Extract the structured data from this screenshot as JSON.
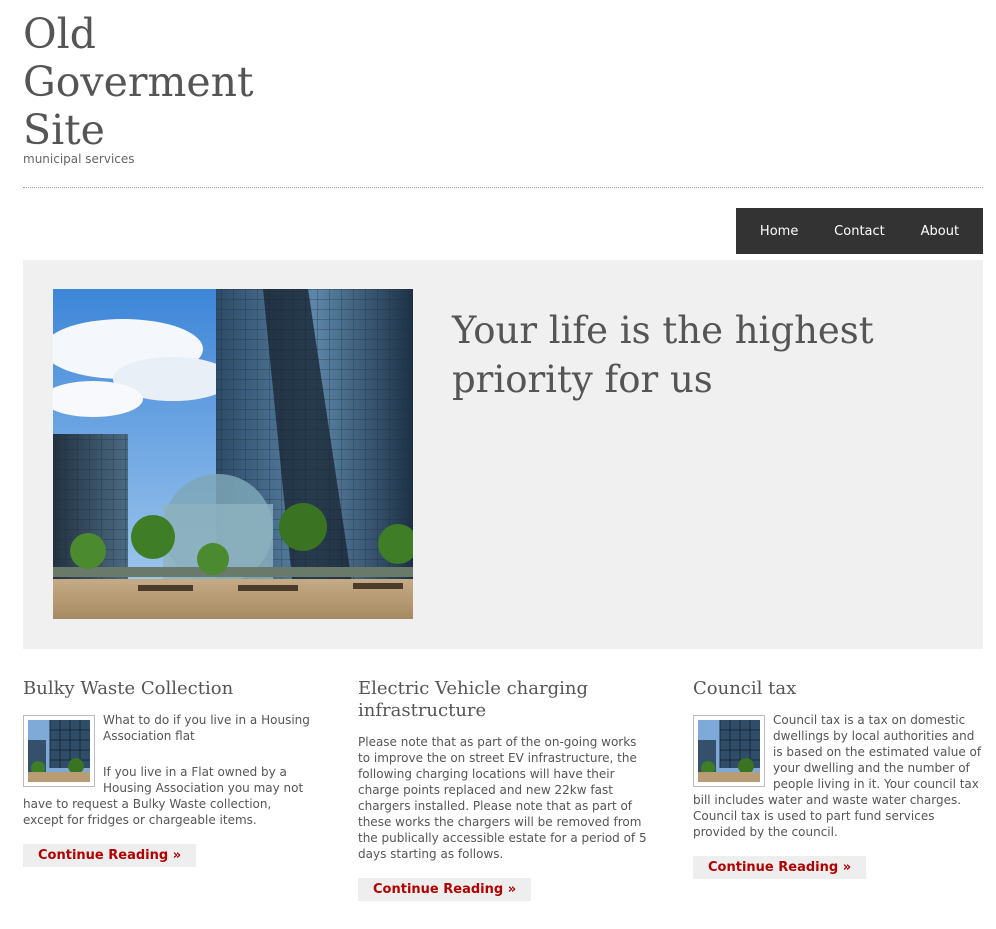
{
  "header": {
    "site_title": "Old Goverment Site",
    "tagline": "municipal services"
  },
  "nav": {
    "items": [
      "Home",
      "Contact",
      "About"
    ]
  },
  "hero": {
    "heading": "Your life is the highest priority for us"
  },
  "articles": [
    {
      "title": "Bulky Waste Collection",
      "paragraphs": [
        "What to do if you live in a Housing Association flat",
        "If you live in a Flat owned by a Housing Association you may not have to request a Bulky Waste collection, except for fridges or chargeable items."
      ],
      "more": "Continue Reading »"
    },
    {
      "title": "Electric Vehicle charging infrastructure",
      "paragraphs": [
        "Please note that as part of the on-going works to improve the on street EV infrastructure, the following charging locations will have their charge points replaced and new 22kw fast chargers installed. Please note that as part of these works the chargers will be removed from the publically accessible estate for a period of 5 days starting as follows."
      ],
      "more": "Continue Reading »"
    },
    {
      "title": "Council tax",
      "paragraphs": [
        "Council tax is a tax on domestic dwellings by local authorities and is based on the estimated value of your dwelling and the number of people living in it. Your council tax bill includes water and waste water charges. Council tax is used to part fund services provided by the council."
      ],
      "more": "Continue Reading »"
    }
  ]
}
